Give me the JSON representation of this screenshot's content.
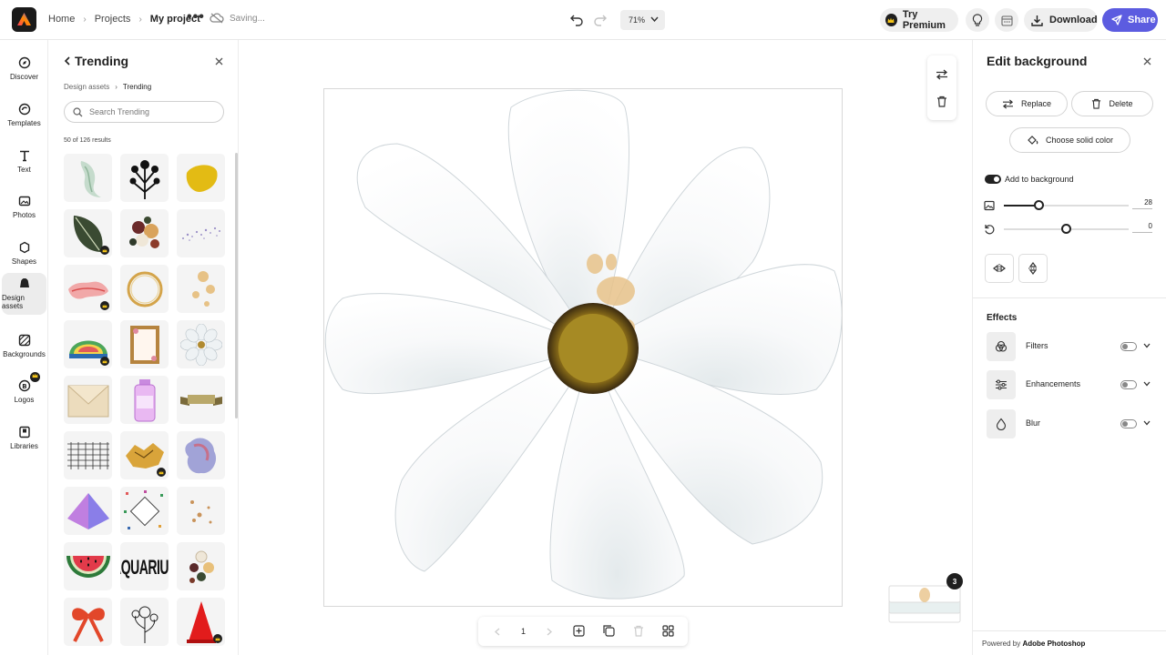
{
  "header": {
    "breadcrumbs": [
      "Home",
      "Projects",
      "My project"
    ],
    "more_label": "•••",
    "status": "Saving...",
    "zoom": "71%",
    "premium_label": "Try Premium",
    "download_label": "Download",
    "share_label": "Share"
  },
  "rail": {
    "items": [
      {
        "label": "Discover",
        "icon": "compass-icon"
      },
      {
        "label": "Templates",
        "icon": "templates-icon"
      },
      {
        "label": "Text",
        "icon": "text-icon"
      },
      {
        "label": "Photos",
        "icon": "photo-icon"
      },
      {
        "label": "Shapes",
        "icon": "shapes-icon"
      },
      {
        "label": "Design assets",
        "icon": "design-assets-icon"
      },
      {
        "label": "Backgrounds",
        "icon": "backgrounds-icon"
      },
      {
        "label": "Logos",
        "icon": "logos-icon"
      },
      {
        "label": "Libraries",
        "icon": "libraries-icon"
      }
    ],
    "active": "Design assets"
  },
  "assets_panel": {
    "title": "Trending",
    "breadcrumbs": [
      "Design assets",
      "Trending"
    ],
    "search_placeholder": "Search Trending",
    "results": "50 of 126 results",
    "tiles": [
      {
        "name": "watercolor-swash",
        "premium": false
      },
      {
        "name": "black-flowers",
        "premium": false
      },
      {
        "name": "yellow-blob",
        "premium": false
      },
      {
        "name": "green-leaf",
        "premium": true
      },
      {
        "name": "flower-bouquet",
        "premium": false
      },
      {
        "name": "dot-splatter",
        "premium": false
      },
      {
        "name": "pink-brush-stroke",
        "premium": true
      },
      {
        "name": "gold-ring",
        "premium": false
      },
      {
        "name": "coffee-stains",
        "premium": false
      },
      {
        "name": "colorful-badge",
        "premium": true
      },
      {
        "name": "floral-frame",
        "premium": false
      },
      {
        "name": "white-daisy",
        "premium": false
      },
      {
        "name": "envelope",
        "premium": false
      },
      {
        "name": "pink-jar",
        "premium": false
      },
      {
        "name": "ribbon-banner",
        "premium": false
      },
      {
        "name": "grid-sketch",
        "premium": false
      },
      {
        "name": "gold-foil",
        "premium": true
      },
      {
        "name": "watercolor-cloud",
        "premium": false
      },
      {
        "name": "purple-pyramid",
        "premium": false
      },
      {
        "name": "confetti-frame",
        "premium": false
      },
      {
        "name": "gold-dots",
        "premium": false
      },
      {
        "name": "watermelon-slice",
        "premium": false
      },
      {
        "name": "aquarius-text",
        "premium": false,
        "text": "AQUARIUS"
      },
      {
        "name": "floral-cluster",
        "premium": false
      },
      {
        "name": "red-bow",
        "premium": false
      },
      {
        "name": "line-flowers",
        "premium": false
      },
      {
        "name": "red-cone",
        "premium": true
      }
    ]
  },
  "canvas": {
    "page_number": "1",
    "pages_count": "3"
  },
  "right_panel": {
    "title": "Edit background",
    "replace_label": "Replace",
    "delete_label": "Delete",
    "solid_color_label": "Choose solid color",
    "add_to_background_label": "Add to background",
    "add_to_background_on": true,
    "blur_slider": {
      "value": "28",
      "fraction": 0.28
    },
    "rotate_slider": {
      "value": "0",
      "fraction": 0.5
    },
    "effects_title": "Effects",
    "effects": [
      {
        "label": "Filters",
        "icon": "filters-icon",
        "on": false
      },
      {
        "label": "Enhancements",
        "icon": "enhancements-icon",
        "on": false
      },
      {
        "label": "Blur",
        "icon": "blur-drop-icon",
        "on": false
      }
    ],
    "powered_prefix": "Powered by",
    "powered_brand": "Adobe Photoshop"
  },
  "colors": {
    "accent": "#5c5ce0",
    "dark": "#1f1f1f"
  }
}
